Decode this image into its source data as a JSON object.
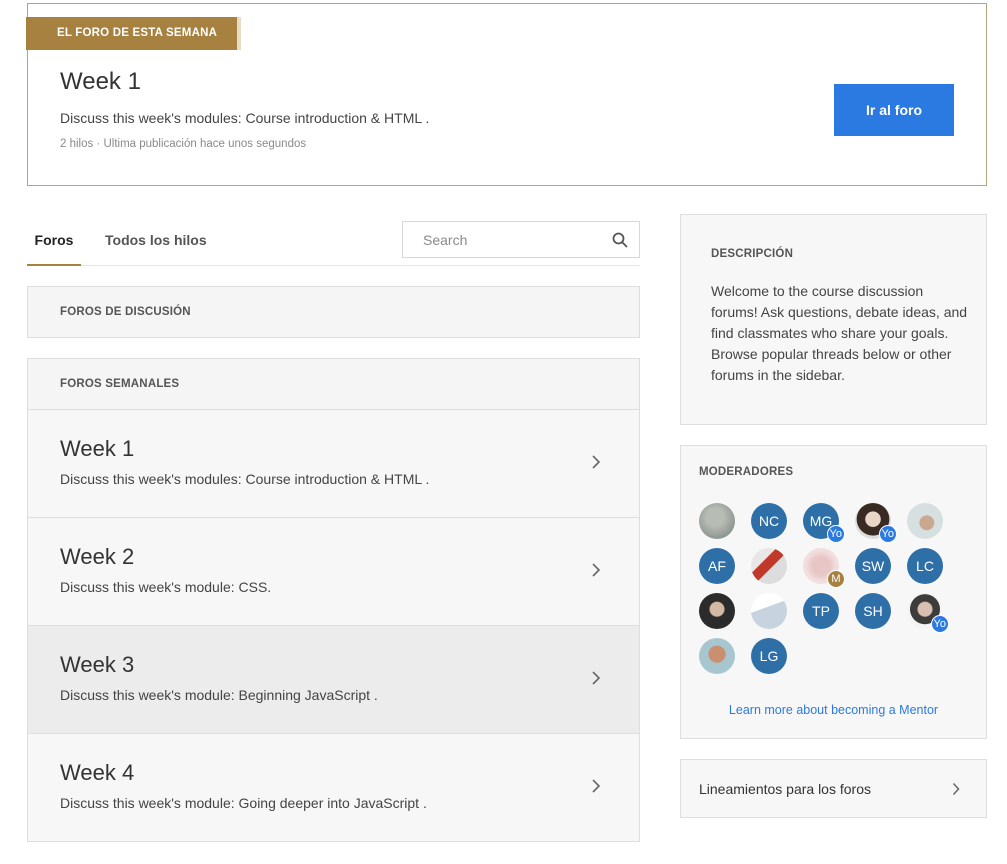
{
  "featured": {
    "ribbon": "EL FORO DE ESTA SEMANA",
    "title": "Week 1",
    "description": "Discuss this week's modules: Course introduction & HTML .",
    "meta": "2 hilos · Ultima publicación hace unos segundos",
    "button_label": "Ir al foro"
  },
  "tabs": [
    {
      "label": "Foros",
      "active": true
    },
    {
      "label": "Todos los hilos",
      "active": false
    }
  ],
  "search": {
    "placeholder": "Search",
    "value": ""
  },
  "sections": {
    "discusion_header": "FOROS DE DISCUSIÓN",
    "semanales_header": "FOROS SEMANALES"
  },
  "weeks": [
    {
      "title": "Week 1",
      "description": "Discuss this week's modules: Course introduction & HTML ."
    },
    {
      "title": "Week 2",
      "description": "Discuss this week's module: CSS."
    },
    {
      "title": "Week 3",
      "description": "Discuss this week's module: Beginning JavaScript ."
    },
    {
      "title": "Week 4",
      "description": "Discuss this week's module: Going deeper into JavaScript ."
    }
  ],
  "sidebar": {
    "description_header": "DESCRIPCIÓN",
    "description_text": "Welcome to the course discussion forums! Ask questions, debate ideas, and find classmates who share your goals. Browse popular threads below or other forums in the sidebar.",
    "moderators_header": "MODERADORES",
    "moderators": [
      {
        "initials": "",
        "photo": true,
        "badge": ""
      },
      {
        "initials": "NC",
        "photo": false,
        "badge": ""
      },
      {
        "initials": "MG",
        "photo": false,
        "badge": "Yo"
      },
      {
        "initials": "",
        "photo": true,
        "badge": "Yo"
      },
      {
        "initials": "",
        "photo": true,
        "badge": ""
      },
      {
        "initials": "AF",
        "photo": false,
        "badge": ""
      },
      {
        "initials": "",
        "photo": true,
        "badge": ""
      },
      {
        "initials": "",
        "photo": true,
        "badge": "M"
      },
      {
        "initials": "SW",
        "photo": false,
        "badge": ""
      },
      {
        "initials": "LC",
        "photo": false,
        "badge": ""
      },
      {
        "initials": "",
        "photo": true,
        "badge": ""
      },
      {
        "initials": "",
        "photo": true,
        "badge": ""
      },
      {
        "initials": "TP",
        "photo": false,
        "badge": ""
      },
      {
        "initials": "SH",
        "photo": false,
        "badge": ""
      },
      {
        "initials": "",
        "photo": true,
        "badge": "Yo"
      },
      {
        "initials": "",
        "photo": true,
        "badge": ""
      },
      {
        "initials": "LG",
        "photo": false,
        "badge": ""
      }
    ],
    "learn_more": "Learn more about becoming a Mentor",
    "guidelines_label": "Lineamientos para los foros"
  },
  "colors": {
    "accent_gold": "#a6813f",
    "primary_blue": "#2a7ae2",
    "avatar_blue": "#2f6fa8"
  }
}
